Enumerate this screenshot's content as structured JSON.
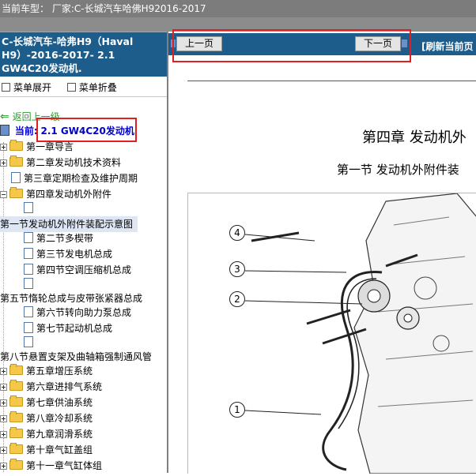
{
  "header": {
    "title": "当前车型：  厂家:C-长城汽车哈佛H92016-2017"
  },
  "sidebar": {
    "title": "C-长城汽车-哈弗H9（Haval H9）-2016-2017- 2.1 GW4C20发动机.",
    "menu_expand": "菜单展开",
    "menu_collapse": "菜单折叠",
    "back": "返回上一级",
    "current_prefix": "当前:",
    "current_value": "2.1 GW4C20发动机",
    "tree": [
      "第一章导言",
      "第二章发动机技术资料",
      "第三章定期检查及维护周期",
      "第四章发动机外附件",
      "第一节发动机外附件装配示意图",
      "第二节多楔带",
      "第三节发电机总成",
      "第四节空调压缩机总成",
      "第五节惰轮总成与皮带张紧器总成",
      "第六节转向助力泵总成",
      "第七节起动机总成",
      "第八节悬置支架及曲轴箱强制通风管",
      "第五章增压系统",
      "第六章进排气系统",
      "第七章供油系统",
      "第八章冷却系统",
      "第九章润滑系统",
      "第十章气缸盖组",
      "第十一章气缸体组"
    ]
  },
  "viewer": {
    "prev": "上一页",
    "next": "下一页",
    "refresh": "[刷新当前页",
    "chapter": "第四章  发动机外",
    "section": "第一节  发动机外附件装",
    "callouts": [
      "4",
      "3",
      "2",
      "1"
    ]
  }
}
